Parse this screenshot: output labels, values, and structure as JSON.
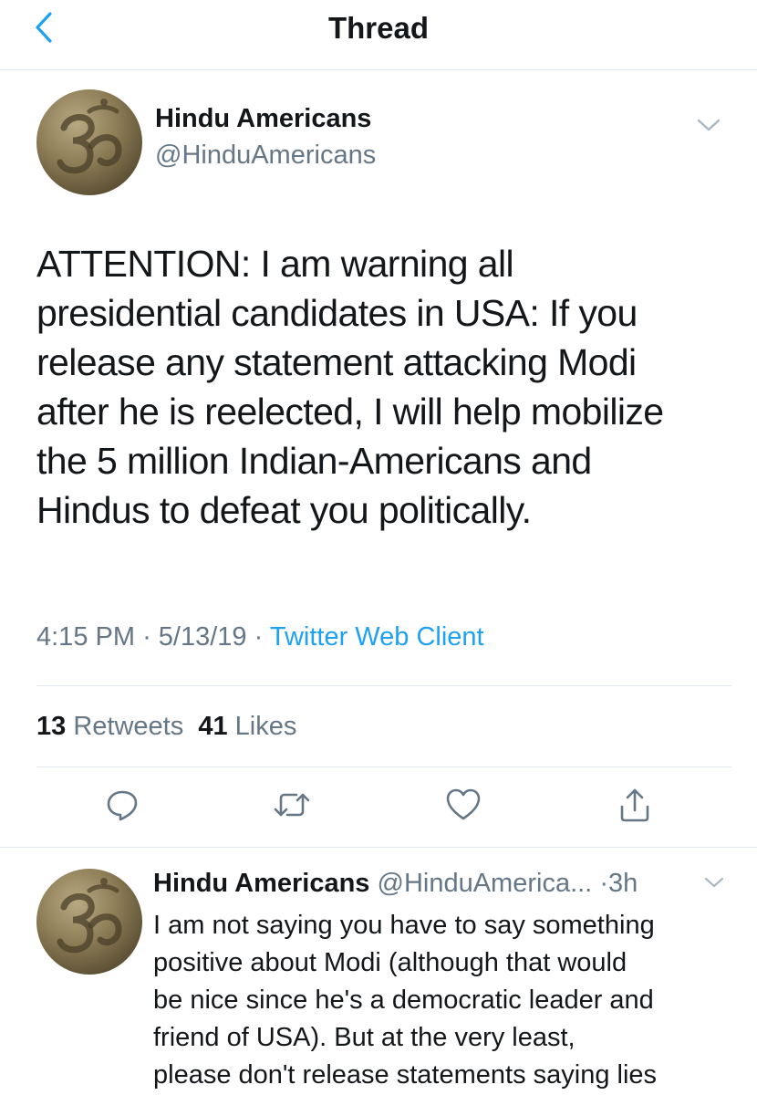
{
  "header": {
    "title": "Thread"
  },
  "main_tweet": {
    "author_name": "Hindu Americans",
    "author_handle": "@HinduAmericans",
    "text_lines": [
      "ATTENTION: I am warning all",
      "presidential candidates in USA: If you",
      "release any statement attacking Modi",
      "after he is reelected, I will help mobilize",
      "the 5 million Indian-Americans and",
      "Hindus to defeat you politically."
    ],
    "time": "4:15 PM",
    "date": "5/13/19",
    "separator": "·",
    "source": "Twitter Web Client",
    "retweet_count": "13",
    "retweet_label": "Retweets",
    "like_count": "41",
    "like_label": "Likes"
  },
  "actions": {
    "reply_icon": "reply-icon",
    "retweet_icon": "retweet-icon",
    "like_icon": "heart-icon",
    "share_icon": "share-icon"
  },
  "reply_tweet": {
    "author_name": "Hindu Americans",
    "author_handle": "@HinduAmerica...",
    "separator": "·",
    "time": "3h",
    "text_lines": [
      "I am not saying you have to say something",
      "positive about Modi (although that would",
      "be nice since he's a democratic leader and",
      "friend of USA). But at the very least,",
      "please don't release statements saying lies"
    ]
  },
  "colors": {
    "accent": "#1da1f2",
    "secondary_text": "#657786",
    "divider": "#e1e8ed",
    "primary_text": "#14171a"
  }
}
